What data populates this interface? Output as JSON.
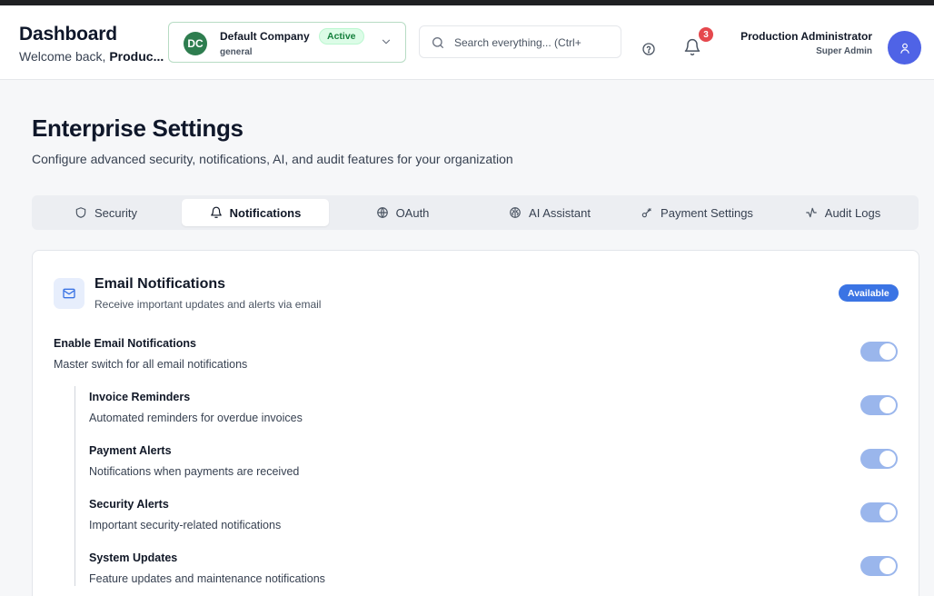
{
  "header": {
    "title": "Dashboard",
    "welcome_prefix": "Welcome back, ",
    "welcome_name": "Produc...",
    "company": {
      "initials": "DC",
      "name": "Default Company",
      "status": "Active",
      "subtitle": "general"
    },
    "search": {
      "placeholder": "Search everything... (Ctrl+"
    },
    "notifications_count": "3",
    "user": {
      "name": "Production Administrator",
      "role": "Super Admin"
    }
  },
  "page": {
    "title": "Enterprise Settings",
    "subtitle": "Configure advanced security, notifications, AI, and audit features for your organization"
  },
  "tabs": [
    {
      "label": "Security",
      "icon": "shield-icon",
      "active": false
    },
    {
      "label": "Notifications",
      "icon": "bell-icon",
      "active": true
    },
    {
      "label": "OAuth",
      "icon": "globe-icon",
      "active": false
    },
    {
      "label": "AI Assistant",
      "icon": "brain-icon",
      "active": false
    },
    {
      "label": "Payment Settings",
      "icon": "key-icon",
      "active": false
    },
    {
      "label": "Audit Logs",
      "icon": "activity-icon",
      "active": false
    }
  ],
  "email_card": {
    "title": "Email Notifications",
    "subtitle": "Receive important updates and alerts via email",
    "badge": "Available",
    "master": {
      "title": "Enable Email Notifications",
      "description": "Master switch for all email notifications",
      "enabled": true
    },
    "items": [
      {
        "title": "Invoice Reminders",
        "description": "Automated reminders for overdue invoices",
        "enabled": true
      },
      {
        "title": "Payment Alerts",
        "description": "Notifications when payments are received",
        "enabled": true
      },
      {
        "title": "Security Alerts",
        "description": "Important security-related notifications",
        "enabled": true
      },
      {
        "title": "System Updates",
        "description": "Feature updates and maintenance notifications",
        "enabled": true
      }
    ]
  },
  "colors": {
    "accent": "#3b74e4",
    "company_avatar": "#2e7d4f",
    "user_avatar": "#4f63e6",
    "toggle_on": "#9ab6ec",
    "notification_badge": "#e5484d"
  }
}
